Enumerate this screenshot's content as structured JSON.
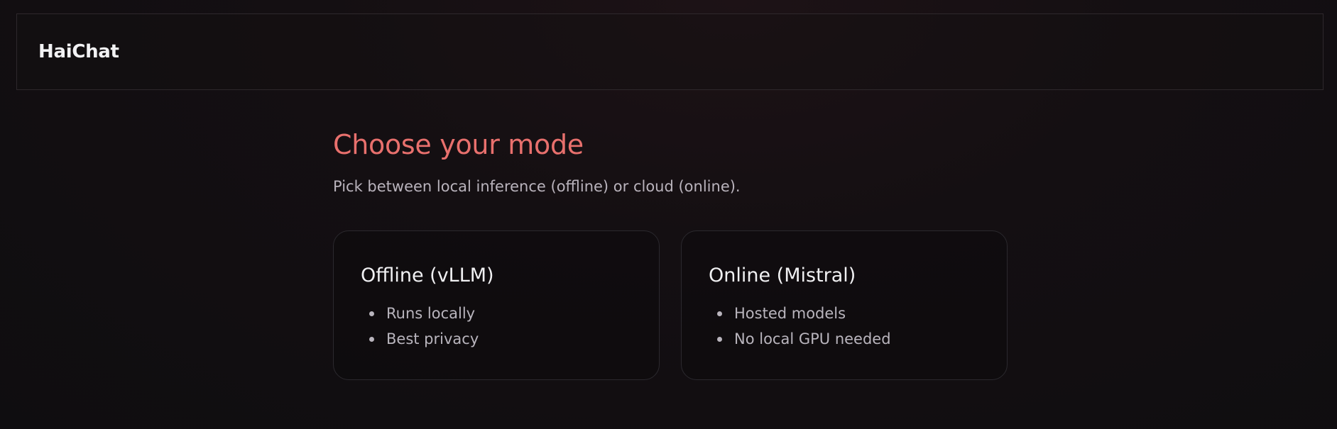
{
  "app": {
    "brand": "HaiChat"
  },
  "main": {
    "title": "Choose your mode",
    "subtitle": "Pick between local inference (offline) or cloud (online)."
  },
  "cards": [
    {
      "title": "Offline (vLLM)",
      "features": [
        "Runs locally",
        "Best privacy"
      ]
    },
    {
      "title": "Online (Mistral)",
      "features": [
        "Hosted models",
        "No local GPU needed"
      ]
    }
  ],
  "colors": {
    "accent": "#e8706d",
    "background": "#120f11",
    "card_border": "#2b292e"
  }
}
